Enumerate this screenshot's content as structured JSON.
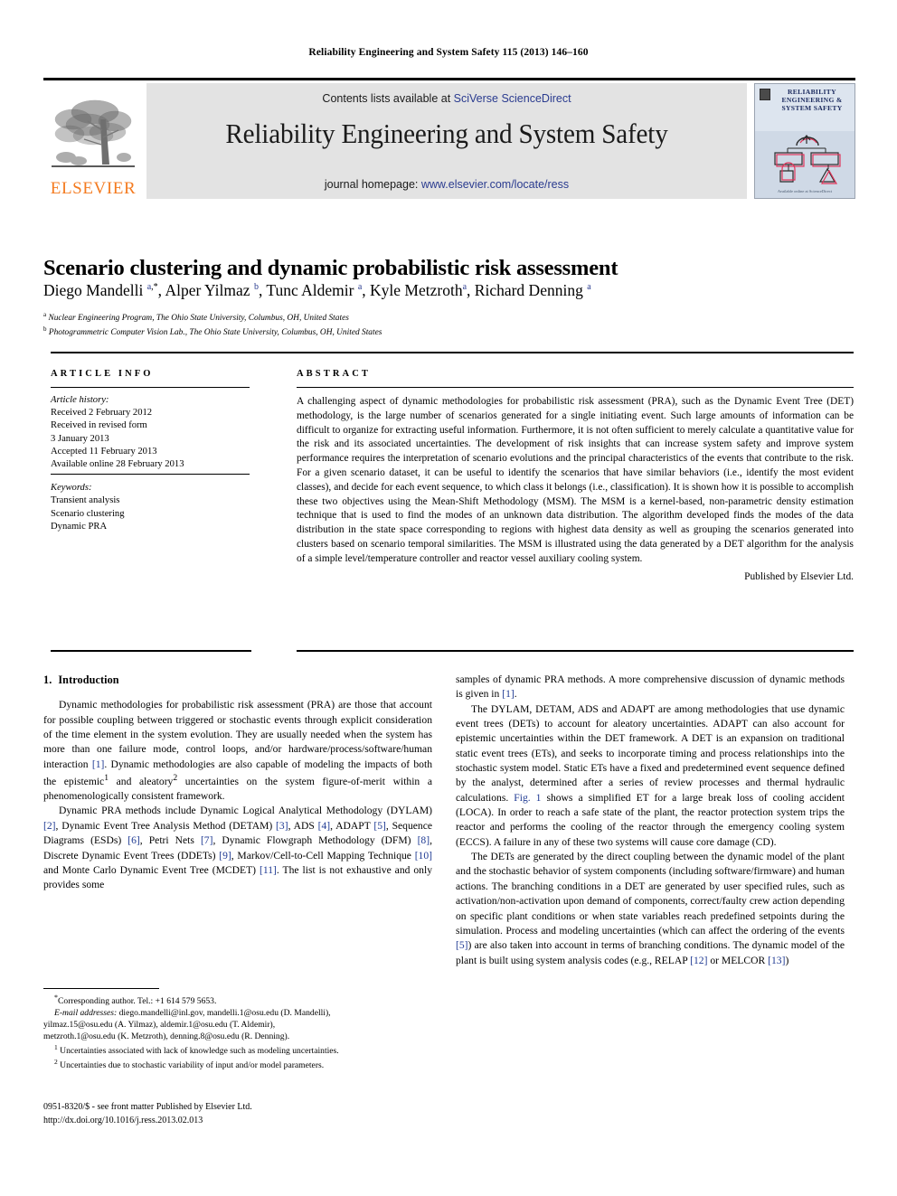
{
  "running_head": "Reliability Engineering and System Safety 115 (2013) 146–160",
  "masthead": {
    "contents_prefix": "Contents lists available at ",
    "contents_link": "SciVerse ScienceDirect",
    "journal_title": "Reliability Engineering and System Safety",
    "homepage_prefix": "journal homepage: ",
    "homepage_link": "www.elsevier.com/locate/ress",
    "publisher_wordmark": "ELSEVIER",
    "cover_title": "RELIABILITY ENGINEERING & SYSTEM SAFETY",
    "cover_footer": "Available online at\nScienceDirect"
  },
  "article": {
    "title": "Scenario clustering and dynamic probabilistic risk assessment",
    "authors_html": "Diego Mandelli <sup>a</sup><sup class=\"star\">,*</sup>, Alper Yilmaz <sup>b</sup>, Tunc Aldemir <sup>a</sup>, Kyle Metzroth<sup>a</sup>, Richard Denning <sup>a</sup>",
    "affiliation_a": "Nuclear Engineering Program, The Ohio State University, Columbus, OH, United States",
    "affiliation_b": "Photogrammetric Computer Vision Lab., The Ohio State University, Columbus, OH, United States"
  },
  "article_info": {
    "heading": "ARTICLE INFO",
    "history_heading": "Article history:",
    "history_lines": [
      "Received 2 February 2012",
      "Received in revised form",
      "3 January 2013",
      "Accepted 11 February 2013",
      "Available online 28 February 2013"
    ],
    "keywords_heading": "Keywords:",
    "keywords": [
      "Transient analysis",
      "Scenario clustering",
      "Dynamic PRA"
    ]
  },
  "abstract": {
    "heading": "ABSTRACT",
    "text": "A challenging aspect of dynamic methodologies for probabilistic risk assessment (PRA), such as the Dynamic Event Tree (DET) methodology, is the large number of scenarios generated for a single initiating event. Such large amounts of information can be difficult to organize for extracting useful information. Furthermore, it is not often sufficient to merely calculate a quantitative value for the risk and its associated uncertainties. The development of risk insights that can increase system safety and improve system performance requires the interpretation of scenario evolutions and the principal characteristics of the events that contribute to the risk. For a given scenario dataset, it can be useful to identify the scenarios that have similar behaviors (i.e., identify the most evident classes), and decide for each event sequence, to which class it belongs (i.e., classification). It is shown how it is possible to accomplish these two objectives using the Mean-Shift Methodology (MSM). The MSM is a kernel-based, non-parametric density estimation technique that is used to find the modes of an unknown data distribution. The algorithm developed finds the modes of the data distribution in the state space corresponding to regions with highest data density as well as grouping the scenarios generated into clusters based on scenario temporal similarities. The MSM is illustrated using the data generated by a DET algorithm for the analysis of a simple level/temperature controller and reactor vessel auxiliary cooling system.",
    "signature": "Published by Elsevier Ltd."
  },
  "body": {
    "section_number": "1.",
    "section_title": "Introduction",
    "left_paragraphs": [
      "Dynamic methodologies for probabilistic risk assessment (PRA) are those that account for possible coupling between triggered or stochastic events through explicit consideration of the time element in the system evolution. They are usually needed when the system has more than one failure mode, control loops, and/or hardware/process/software/human interaction <span class=\"ref\">[1]</span>. Dynamic methodologies are also capable of modeling the impacts of both the epistemic<sup>1</sup> and aleatory<sup>2</sup> uncertainties on the system figure-of-merit within a phenomenologically consistent framework.",
      "Dynamic PRA methods include Dynamic Logical Analytical Methodology (DYLAM) <span class=\"ref\">[2]</span>, Dynamic Event Tree Analysis Method (DETAM) <span class=\"ref\">[3]</span>, ADS <span class=\"ref\">[4]</span>, ADAPT <span class=\"ref\">[5]</span>, Sequence Diagrams (ESDs) <span class=\"ref\">[6]</span>, Petri Nets <span class=\"ref\">[7]</span>, Dynamic Flowgraph Methodology (DFM) <span class=\"ref\">[8]</span>, Discrete Dynamic Event Trees (DDETs) <span class=\"ref\">[9]</span>, Markov/Cell-to-Cell Mapping Technique <span class=\"ref\">[10]</span> and Monte Carlo Dynamic Event Tree (MCDET) <span class=\"ref\">[11]</span>. The list is not exhaustive and only provides some"
    ],
    "right_paragraphs": [
      "samples of dynamic PRA methods. A more comprehensive discussion of dynamic methods is given in <span class=\"ref\">[1]</span>.",
      "The DYLAM, DETAM, ADS and ADAPT are among methodologies that use dynamic event trees (DETs) to account for aleatory uncertainties. ADAPT can also account for epistemic uncertainties within the DET framework. A DET is an expansion on traditional static event trees (ETs), and seeks to incorporate timing and process relationships into the stochastic system model. Static ETs have a fixed and predetermined event sequence defined by the analyst, determined after a series of review processes and thermal hydraulic calculations. <span class=\"ref\">Fig. 1</span> shows a simplified ET for a large break loss of cooling accident (LOCA). In order to reach a safe state of the plant, the reactor protection system trips the reactor and performs the cooling of the reactor through the emergency cooling system (ECCS). A failure in any of these two systems will cause core damage (CD).",
      "The DETs are generated by the direct coupling between the dynamic model of the plant and the stochastic behavior of system components (including software/firmware) and human actions. The branching conditions in a DET are generated by user specified rules, such as activation/non-activation upon demand of components, correct/faulty crew action depending on specific plant conditions or when state variables reach predefined setpoints during the simulation. Process and modeling uncertainties (which can affect the ordering of the events <span class=\"ref\">[5]</span>) are also taken into account in terms of branching conditions. The dynamic model of the plant is built using system analysis codes (e.g., RELAP <span class=\"ref\">[12]</span> or MELCOR <span class=\"ref\">[13]</span>)"
    ]
  },
  "footnotes": {
    "corresponding": "Corresponding author. Tel.: +1 614 579 5653.",
    "email_label": "E-mail addresses:",
    "email_lines": [
      "diego.mandelli@inl.gov, mandelli.1@osu.edu (D. Mandelli),",
      "yilmaz.15@osu.edu (A. Yilmaz), aldemir.1@osu.edu (T. Aldemir),",
      "metzroth.1@osu.edu (K. Metzroth), denning.8@osu.edu (R. Denning)."
    ],
    "note1": "Uncertainties associated with lack of knowledge such as modeling uncertainties.",
    "note2": "Uncertainties due to stochastic variability of input and/or model parameters."
  },
  "colophon": {
    "issn_line": "0951-8320/$ - see front matter Published by Elsevier Ltd.",
    "doi_line": "http://dx.doi.org/10.1016/j.ress.2013.02.013"
  },
  "colors": {
    "link": "#2a3b8f",
    "reference": "#1f3a93",
    "elsevier_orange": "#F47B20",
    "band_grey": "#e3e3e3",
    "cover_blue": "#cfd9e6"
  }
}
